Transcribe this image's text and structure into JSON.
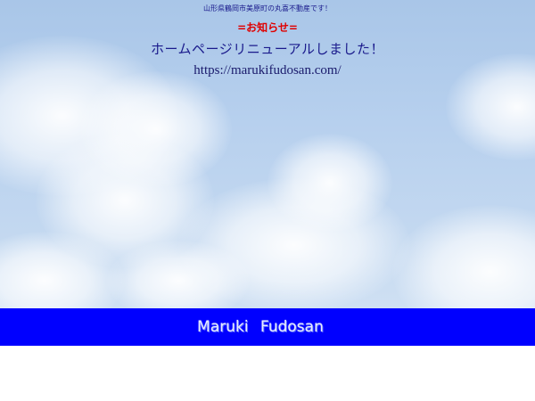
{
  "header": {
    "tagline": "山形県鶴岡市美原町の丸喜不動産です！"
  },
  "notice": {
    "heading": "=お知らせ=",
    "message": "ホームページリニューアルしました！",
    "url": "https://marukifudosan.com/"
  },
  "banner": {
    "logo_text": "Maruki Fudosan"
  },
  "colors": {
    "tagline": "#1a1a8c",
    "notice_heading": "#e00000",
    "banner_background": "#0000ff",
    "page_background": "#ffffff"
  }
}
